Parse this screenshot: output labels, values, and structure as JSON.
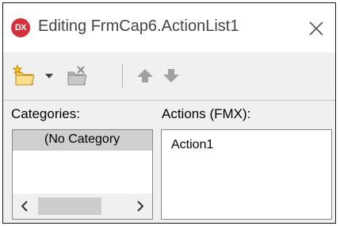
{
  "window": {
    "title": "Editing FrmCap6.ActionList1",
    "app_icon_text": "DX",
    "icon_color": "#d3303a"
  },
  "toolbar": {
    "icons": [
      "new-action-icon",
      "dropdown-arrow-icon",
      "delete-action-icon",
      "move-up-icon",
      "move-down-icon"
    ]
  },
  "panels": {
    "categories_label": "Categories:",
    "actions_label": "Actions (FMX):",
    "categories": [
      "(No Category"
    ],
    "actions": [
      "Action1"
    ]
  }
}
